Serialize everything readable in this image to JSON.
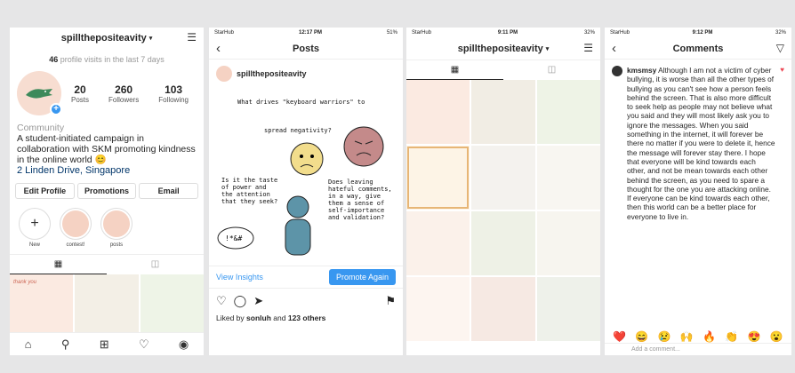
{
  "profile": {
    "username": "spillthepositeavity",
    "visits_count": "46",
    "visits_text": "profile visits in the last 7 days",
    "posts_num": "20",
    "posts_label": "Posts",
    "followers_num": "260",
    "followers_label": "Followers",
    "following_num": "103",
    "following_label": "Following",
    "category": "Community",
    "bio": "A student-initiated campaign in collaboration with SKM promoting kindness in the online world 😊",
    "address": "2 Linden Drive, Singapore",
    "edit_label": "Edit Profile",
    "promotions_label": "Promotions",
    "email_label": "Email",
    "highlights": [
      {
        "label": "New"
      },
      {
        "label": "contest!"
      },
      {
        "label": "posts"
      }
    ]
  },
  "post_screen": {
    "status_carrier": "StarHub",
    "status_time": "12:17 PM",
    "status_battery": "51%",
    "title": "Posts",
    "username": "spillthepositeavity",
    "image_texts": {
      "q1": "What drives \"keyboard warriors\" to",
      "q2": "spread negativity?",
      "q3": "Is it the taste of power and the attention that they seek?",
      "q4": "Does leaving hateful comments, in a way, give them a sense of self-importance and validation?"
    },
    "insights_label": "View Insights",
    "promote_label": "Promote Again",
    "liked_prefix": "Liked by",
    "liked_user": "sonluh",
    "liked_mid": "and",
    "liked_count": "123 others"
  },
  "grid_screen": {
    "status_carrier": "StarHub",
    "status_time": "9:11 PM",
    "status_battery": "32%",
    "username": "spillthepositeavity"
  },
  "comments_screen": {
    "status_carrier": "StarHub",
    "status_time": "9:12 PM",
    "status_battery": "32%",
    "title": "Comments",
    "commenter": "kmsmsy",
    "comment": "Although I am not a victim of cyber bullying, it is worse than all the other types of bullying as you can't see how a person feels behind the screen. That is also more difficult to seek help as people may not believe what you said and they will most likely ask you to ignore the messages. When you said something in the internet, it will forever be there no matter if you were to delete it, hence the message will forever stay there. I hope that everyone will be kind towards each other, and not be mean towards each other behind the screen, as you need to spare a thought for the one you are attacking online. If everyone can be kind towards each other, then this world can be a better place for everyone to live in.",
    "emojis": [
      "❤️",
      "😄",
      "😢",
      "🙌",
      "🔥",
      "👏",
      "😍",
      "😮"
    ],
    "add_placeholder": "Add a comment..."
  }
}
